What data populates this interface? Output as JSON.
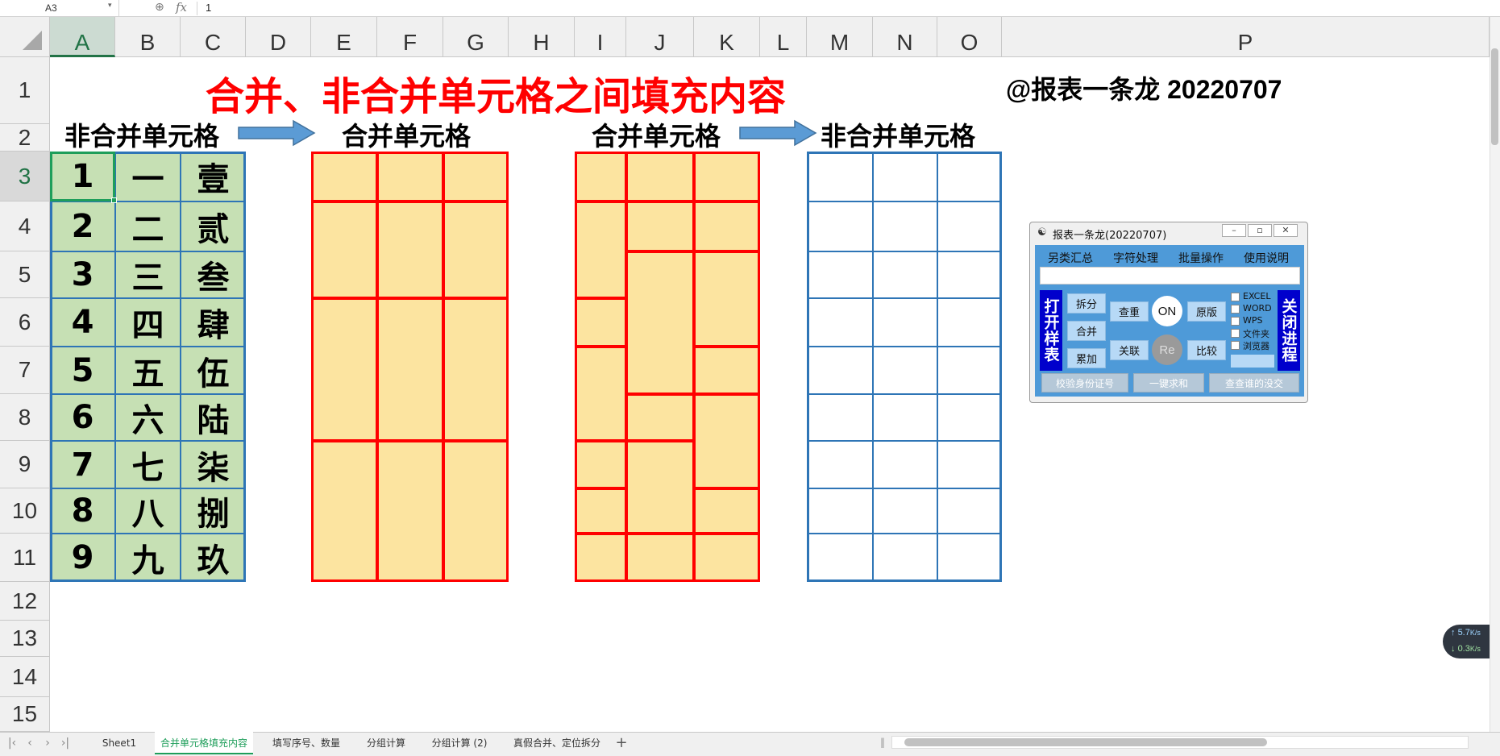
{
  "formula_bar": {
    "name_box": "A3",
    "fx": "fx",
    "value": "1"
  },
  "columns": [
    "A",
    "B",
    "C",
    "D",
    "E",
    "F",
    "G",
    "H",
    "I",
    "J",
    "K",
    "L",
    "M",
    "N",
    "O",
    "P"
  ],
  "rows": [
    "1",
    "2",
    "3",
    "4",
    "5",
    "6",
    "7",
    "8",
    "9",
    "10",
    "11",
    "12",
    "13",
    "14",
    "15"
  ],
  "selected_cell": {
    "column": "A",
    "row": "3"
  },
  "title": "合并、非合并单元格之间填充内容",
  "author": "@报表一条龙 20220707",
  "sections": {
    "non_merged_left": "非合并单元格",
    "merged_mid": "合并单元格",
    "merged_right": "合并单元格",
    "non_merged_right": "非合并单元格"
  },
  "table": {
    "col_a": [
      "1",
      "2",
      "3",
      "4",
      "5",
      "6",
      "7",
      "8",
      "9"
    ],
    "col_b": [
      "一",
      "二",
      "三",
      "四",
      "五",
      "六",
      "七",
      "八",
      "九"
    ],
    "col_c": [
      "壹",
      "贰",
      "叁",
      "肆",
      "伍",
      "陆",
      "柒",
      "捌",
      "玖"
    ]
  },
  "colors": {
    "title": "#ff0000",
    "green_fill": "#c6e0b4",
    "yellow_fill": "#fce4a0",
    "red_border": "#ff0000",
    "blue_border": "#2e75b6",
    "arrow": "#5b9bd5",
    "excel_green": "#217346"
  },
  "tool_window": {
    "title": "报表一条龙(20220707)",
    "menu": [
      "另类汇总",
      "字符处理",
      "批量操作",
      "使用说明"
    ],
    "open_sample": "打开样表",
    "close_process": "关闭进程",
    "buttons": {
      "split": "拆分",
      "merge": "合并",
      "accumulate": "累加",
      "duplicate": "查重",
      "relate": "关联",
      "on": "ON",
      "re": "Re",
      "original": "原版",
      "compare": "比较"
    },
    "checks": [
      "EXCEL",
      "WORD",
      "WPS",
      "文件夹",
      "浏览器"
    ],
    "bottom_buttons": [
      "校验身份证号",
      "一键求和",
      "查查谁的没交"
    ],
    "window_controls": [
      "minimize-icon",
      "maximize-icon",
      "close-icon"
    ]
  },
  "sheets": [
    "Sheet1",
    "合并单元格填充内容",
    "填写序号、数量",
    "分组计算",
    "分组计算 (2)",
    "真假合并、定位拆分"
  ],
  "active_sheet": "合并单元格填充内容",
  "net_speed": {
    "up": "5.7",
    "down": "0.3",
    "unit": "K/s"
  }
}
